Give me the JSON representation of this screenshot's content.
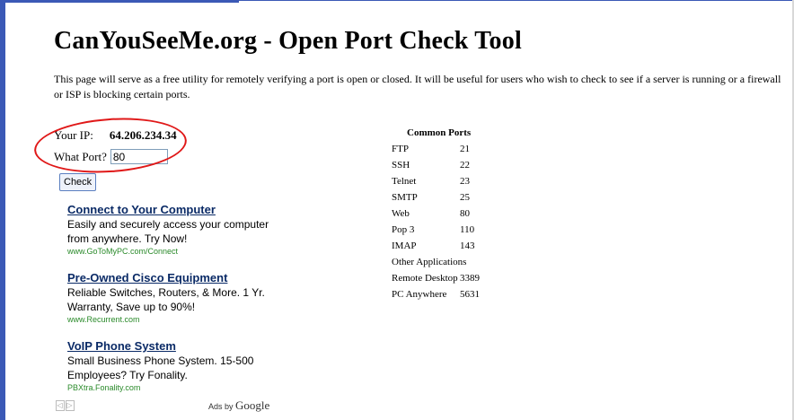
{
  "page": {
    "title": "CanYouSeeMe.org - Open Port Check Tool",
    "intro": "This page will serve as a free utility for remotely verifying a port is open or closed. It will be useful for users who wish to check to see if a server is running or a firewall or ISP is blocking certain ports."
  },
  "form": {
    "ip_label": "Your IP:",
    "ip_value": "64.206.234.34",
    "port_label": "What Port?",
    "port_value": "80",
    "check_label": "Check"
  },
  "ads": [
    {
      "title": "Connect to Your Computer",
      "body": "Easily and securely access your computer from anywhere. Try Now!",
      "url": "www.GoToMyPC.com/Connect"
    },
    {
      "title": "Pre-Owned Cisco Equipment",
      "body": "Reliable Switches, Routers, & More. 1 Yr. Warranty, Save up to 90%!",
      "url": "www.Recurrent.com"
    },
    {
      "title": "VoIP Phone System",
      "body": "Small Business Phone System. 15-500 Employees? Try Fonality.",
      "url": "PBXtra.Fonality.com"
    }
  ],
  "ads_footer": {
    "prev": "◁",
    "next": "▷",
    "ads_by": "Ads by",
    "google": "Google"
  },
  "ports": {
    "title": "Common Ports",
    "rows": [
      {
        "name": "FTP",
        "port": "21"
      },
      {
        "name": "SSH",
        "port": "22"
      },
      {
        "name": "Telnet",
        "port": "23"
      },
      {
        "name": "SMTP",
        "port": "25"
      },
      {
        "name": "Web",
        "port": "80"
      },
      {
        "name": "Pop 3",
        "port": "110"
      },
      {
        "name": "IMAP",
        "port": "143"
      }
    ],
    "other_title": "Other Applications",
    "other_rows": [
      {
        "name": "Remote Desktop",
        "port": "3389"
      },
      {
        "name": "PC Anywhere",
        "port": "5631"
      }
    ]
  },
  "colors": {
    "frame": "#3b59b6",
    "annotation": "#e01818",
    "ad_link": "#0a2a66",
    "ad_url": "#2a8a2a"
  }
}
